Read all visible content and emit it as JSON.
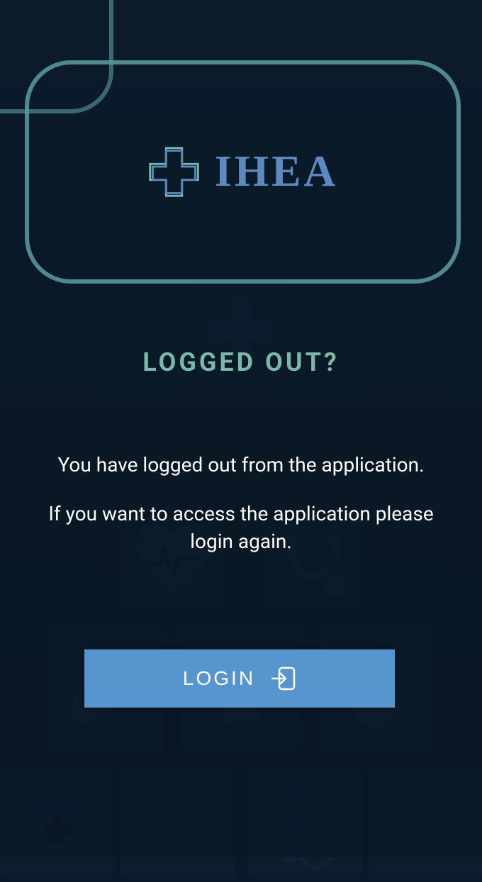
{
  "brand": {
    "name": "IHEA"
  },
  "heading": "LOGGED OUT?",
  "message": {
    "line1": "You have logged out from the application.",
    "line2": "If you want to access the application please login again."
  },
  "actions": {
    "login_label": "LOGIN"
  },
  "colors": {
    "accent_teal": "#7ab8a8",
    "accent_blue": "#6b9ed9",
    "button_blue": "#5795cf",
    "border_teal": "#5c9ca0"
  }
}
